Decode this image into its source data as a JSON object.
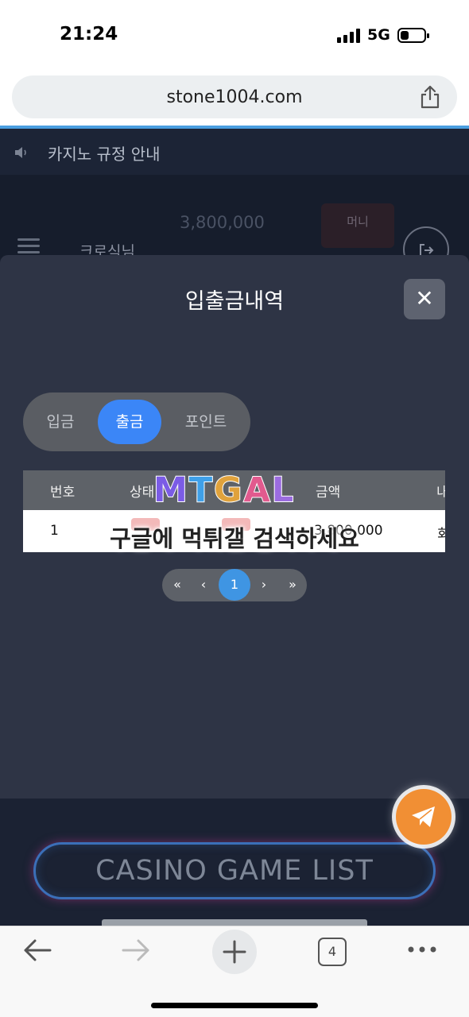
{
  "status_bar": {
    "time": "21:24",
    "network": "5G"
  },
  "browser": {
    "url": "stone1004.com",
    "tab_count": "4"
  },
  "site": {
    "notice": "카지노 규정 안내",
    "balance": "3,800,000",
    "money_button": "머니",
    "nickname": "크로식님",
    "game_list_button": "CASINO GAME LIST"
  },
  "modal": {
    "title": "입출금내역",
    "close": "✕",
    "tabs": [
      {
        "label": "입금",
        "active": false
      },
      {
        "label": "출금",
        "active": true
      },
      {
        "label": "포인트",
        "active": false
      }
    ],
    "table": {
      "headers": [
        "번호",
        "상태",
        "금액",
        "내"
      ],
      "rows": [
        {
          "no": "1",
          "amount": "3,800,000",
          "tail": "회"
        }
      ]
    },
    "pagination": {
      "first": "«",
      "prev": "‹",
      "current": "1",
      "next": "›",
      "last": "»"
    }
  },
  "watermark": {
    "logo": "MTGAL",
    "caption": "구글에 먹튀갤 검색하세요"
  },
  "colors": {
    "accent_blue": "#3b86f7",
    "page_active": "#3f95e3",
    "modal_bg": "#2e3445",
    "fab_orange": "#f18f34"
  }
}
